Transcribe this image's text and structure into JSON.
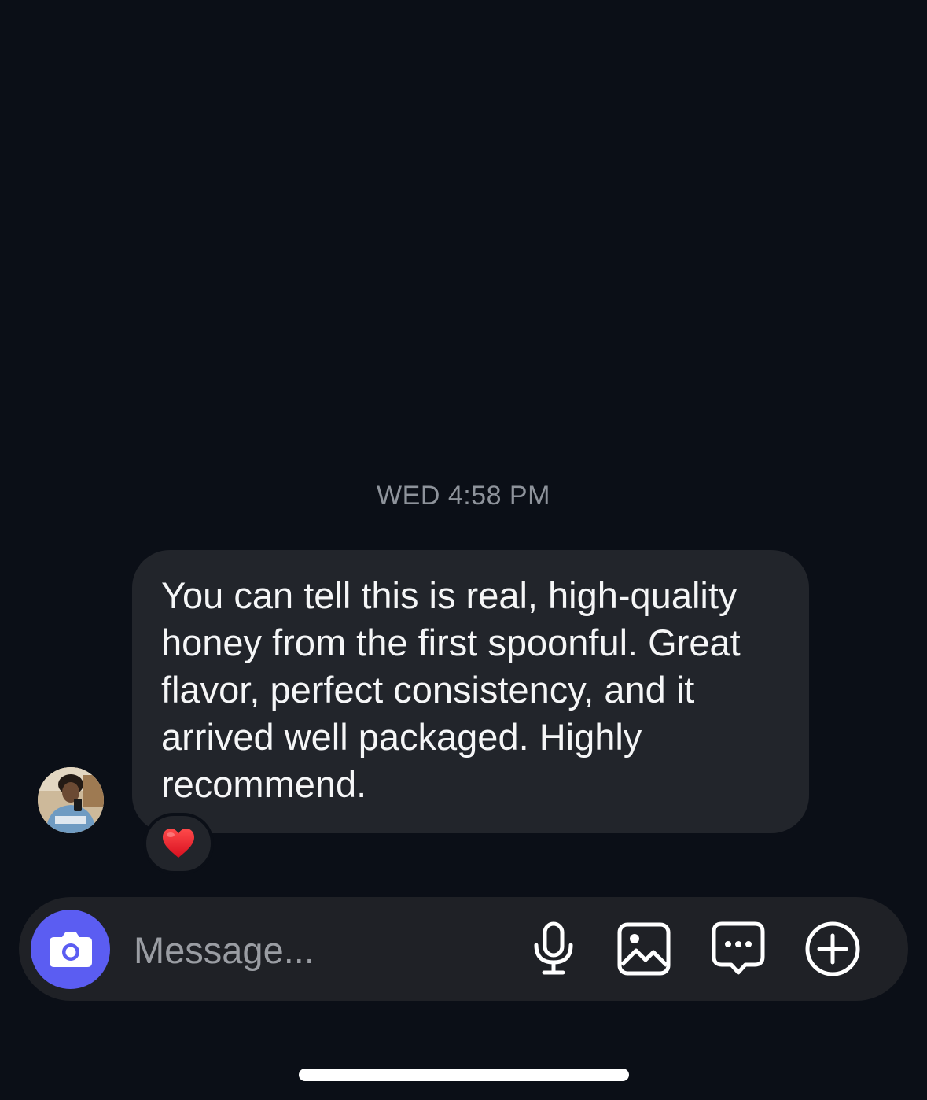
{
  "thread": {
    "timestamp": "WED 4:58 PM"
  },
  "message": {
    "text": "You can tell this is real, high-quality\nhoney from the first spoonful. Great\nflavor, perfect consistency, and it\narrived well packaged. Highly\nrecommend.",
    "reaction": "❤️"
  },
  "composer": {
    "placeholder": "Message..."
  },
  "icons": {
    "camera": "camera-icon",
    "microphone": "microphone-icon",
    "gallery": "gallery-icon",
    "sticker": "chat-bubble-icon",
    "add": "plus-circle-icon"
  },
  "colors": {
    "background": "#0b0f17",
    "bubble": "#22252b",
    "accent": "#5b5df2",
    "timestamp": "#8e939b"
  }
}
